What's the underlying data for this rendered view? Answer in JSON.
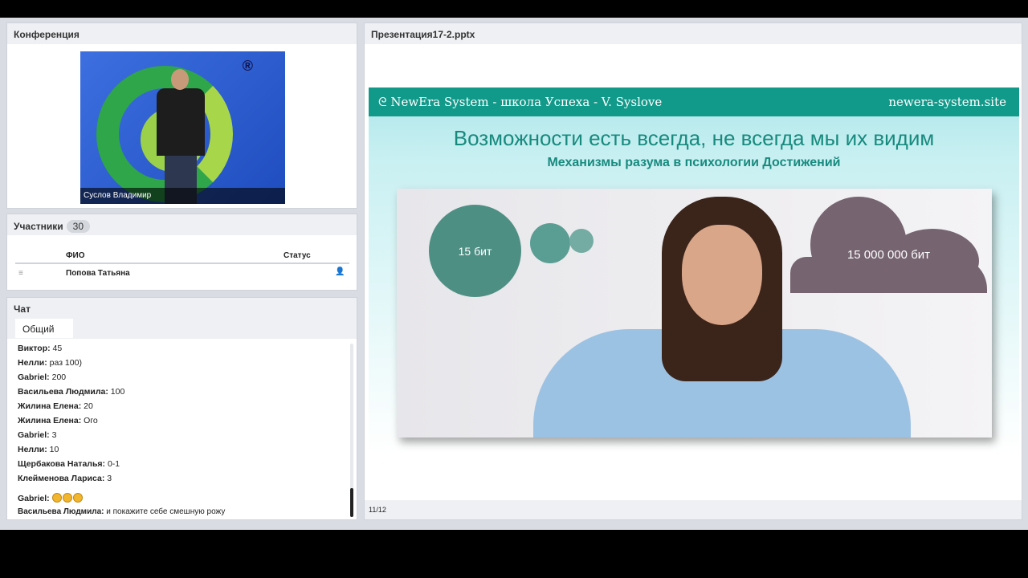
{
  "conference": {
    "title": "Конференция",
    "speaker": "Суслов Владимир",
    "logo_mark": "®"
  },
  "participants": {
    "title": "Участники",
    "count": "30",
    "col_name": "ФИО",
    "col_status": "Статус",
    "rows": [
      {
        "name": "Попова Татьяна"
      }
    ]
  },
  "chat": {
    "title": "Чат",
    "tab": "Общий",
    "messages": [
      {
        "author": "Виктор:",
        "text": "45"
      },
      {
        "author": "Нелли:",
        "text": "раз 100)"
      },
      {
        "author": "Gabriel:",
        "text": "200"
      },
      {
        "author": "Васильева Людмила:",
        "text": "100"
      },
      {
        "author": "Жилина  Елена:",
        "text": "20"
      },
      {
        "author": "Жилина  Елена:",
        "text": "Ого"
      },
      {
        "author": "Gabriel:",
        "text": "3"
      },
      {
        "author": "Нелли:",
        "text": "10"
      },
      {
        "author": "Щербакова Наталья:",
        "text": "0-1"
      },
      {
        "author": "Клейменова Лариса:",
        "text": "3"
      },
      {
        "author": "Gabriel:",
        "text": ""
      },
      {
        "author": "Васильева Людмила:",
        "text": "и покажите себе смешную рожу"
      }
    ]
  },
  "presentation": {
    "title": "Презентация17-2.pptx",
    "page": "11/12",
    "slide": {
      "brand": "NewEra System - школа Успеха - V. Syslove",
      "site": "newera-system.site",
      "heading": "Возможности есть всегда, не всегда мы их видим",
      "subheading": "Механизмы разума в психологии Достижений",
      "small_cloud": "15 бит",
      "big_cloud": "15 000 000 бит"
    }
  }
}
